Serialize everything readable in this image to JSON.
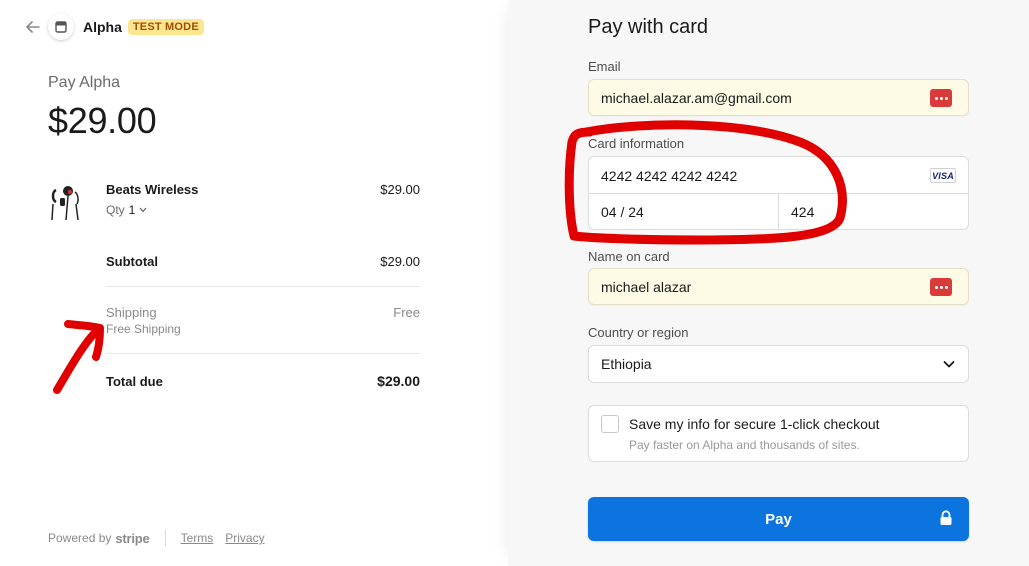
{
  "header": {
    "merchant_name": "Alpha",
    "badge": "TEST MODE"
  },
  "summary": {
    "pay_label": "Pay Alpha",
    "amount": "$29.00",
    "product": {
      "name": "Beats Wireless",
      "qty_label": "Qty",
      "qty_value": "1",
      "price": "$29.00"
    },
    "subtotal_label": "Subtotal",
    "subtotal_value": "$29.00",
    "shipping_label": "Shipping",
    "shipping_sub": "Free Shipping",
    "shipping_value": "Free",
    "total_label": "Total due",
    "total_value": "$29.00"
  },
  "footer": {
    "powered_by": "Powered by",
    "stripe": "stripe",
    "terms": "Terms",
    "privacy": "Privacy"
  },
  "form": {
    "title": "Pay with card",
    "email_label": "Email",
    "email_value": "michael.alazar.am@gmail.com",
    "card_label": "Card information",
    "card_number": "4242 4242 4242 4242",
    "card_brand": "VISA",
    "card_expiry": "04 / 24",
    "card_cvc": "424",
    "name_label": "Name on card",
    "name_value": "michael alazar",
    "country_label": "Country or region",
    "country_value": "Ethiopia",
    "save_title": "Save my info for secure 1-click checkout",
    "save_sub": "Pay faster on Alpha and thousands of sites.",
    "pay_button": "Pay"
  },
  "colors": {
    "accent": "#0b74de",
    "badge_bg": "#fde68f",
    "badge_text": "#a14f00",
    "autofill_bg": "#fdfae5",
    "annotation": "#e00000"
  }
}
